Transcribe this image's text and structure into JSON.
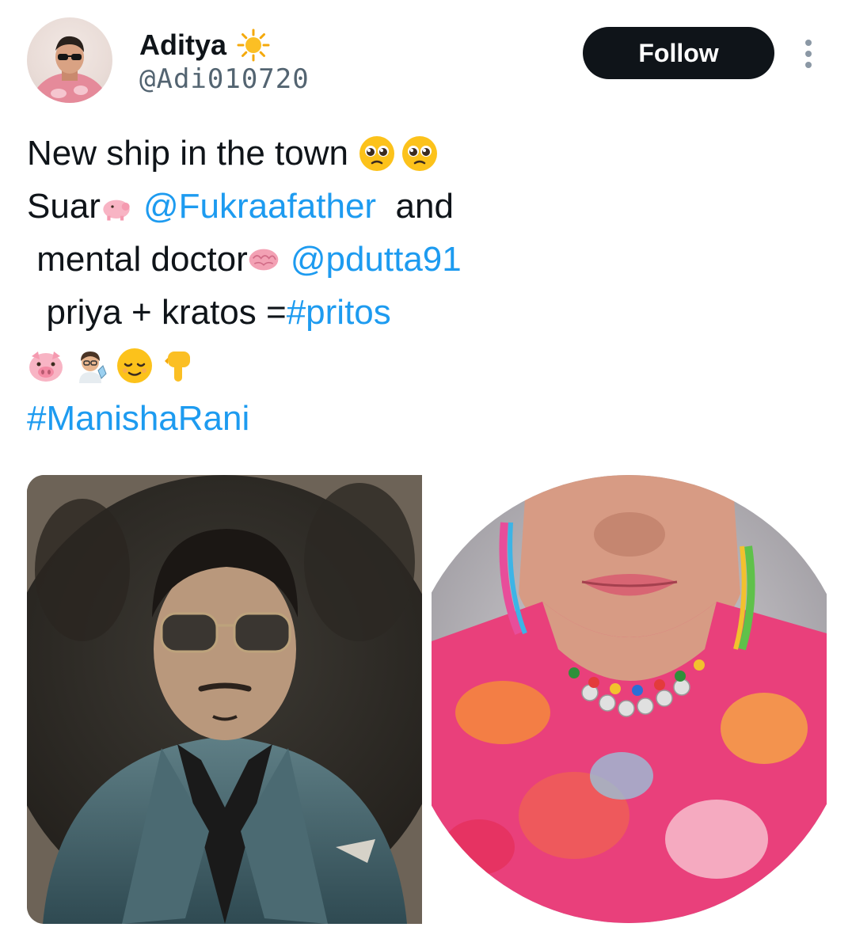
{
  "author": {
    "display_name": "Aditya",
    "handle": "@Adi010720",
    "avatar_icon": "avatar-photo",
    "badge_icon": "sun-emoji"
  },
  "actions": {
    "follow_label": "Follow",
    "more_icon": "more-vertical-icon"
  },
  "tweet": {
    "line1": {
      "text": "New ship in the town ",
      "emojis": [
        "pleading-face-emoji",
        "pleading-face-emoji"
      ]
    },
    "line2": {
      "prefix": "Suar",
      "emoji": "pig-emoji",
      "mention": "@Fukraafather",
      "suffix": "  and"
    },
    "line3": {
      "prefix": " mental doctor",
      "emoji": "brain-emoji",
      "mention": "@pdutta91"
    },
    "line4": {
      "prefix": "  priya + kratos =",
      "hashtag": "#pritos"
    },
    "line5": {
      "emojis": [
        "pig-face-emoji",
        "scientist-emoji",
        "relieved-face-emoji",
        "backhand-index-pointing-down-emoji"
      ]
    },
    "line6": {
      "hashtag": "#ManishaRani"
    }
  },
  "media": [
    {
      "name": "photo-man-in-suit",
      "shape": "circle-crop"
    },
    {
      "name": "photo-woman-with-necklace",
      "shape": "circle-crop"
    }
  ],
  "colors": {
    "link": "#1d9bf0",
    "text": "#0f1419",
    "secondary": "#536471",
    "follow_bg": "#0f1419"
  }
}
